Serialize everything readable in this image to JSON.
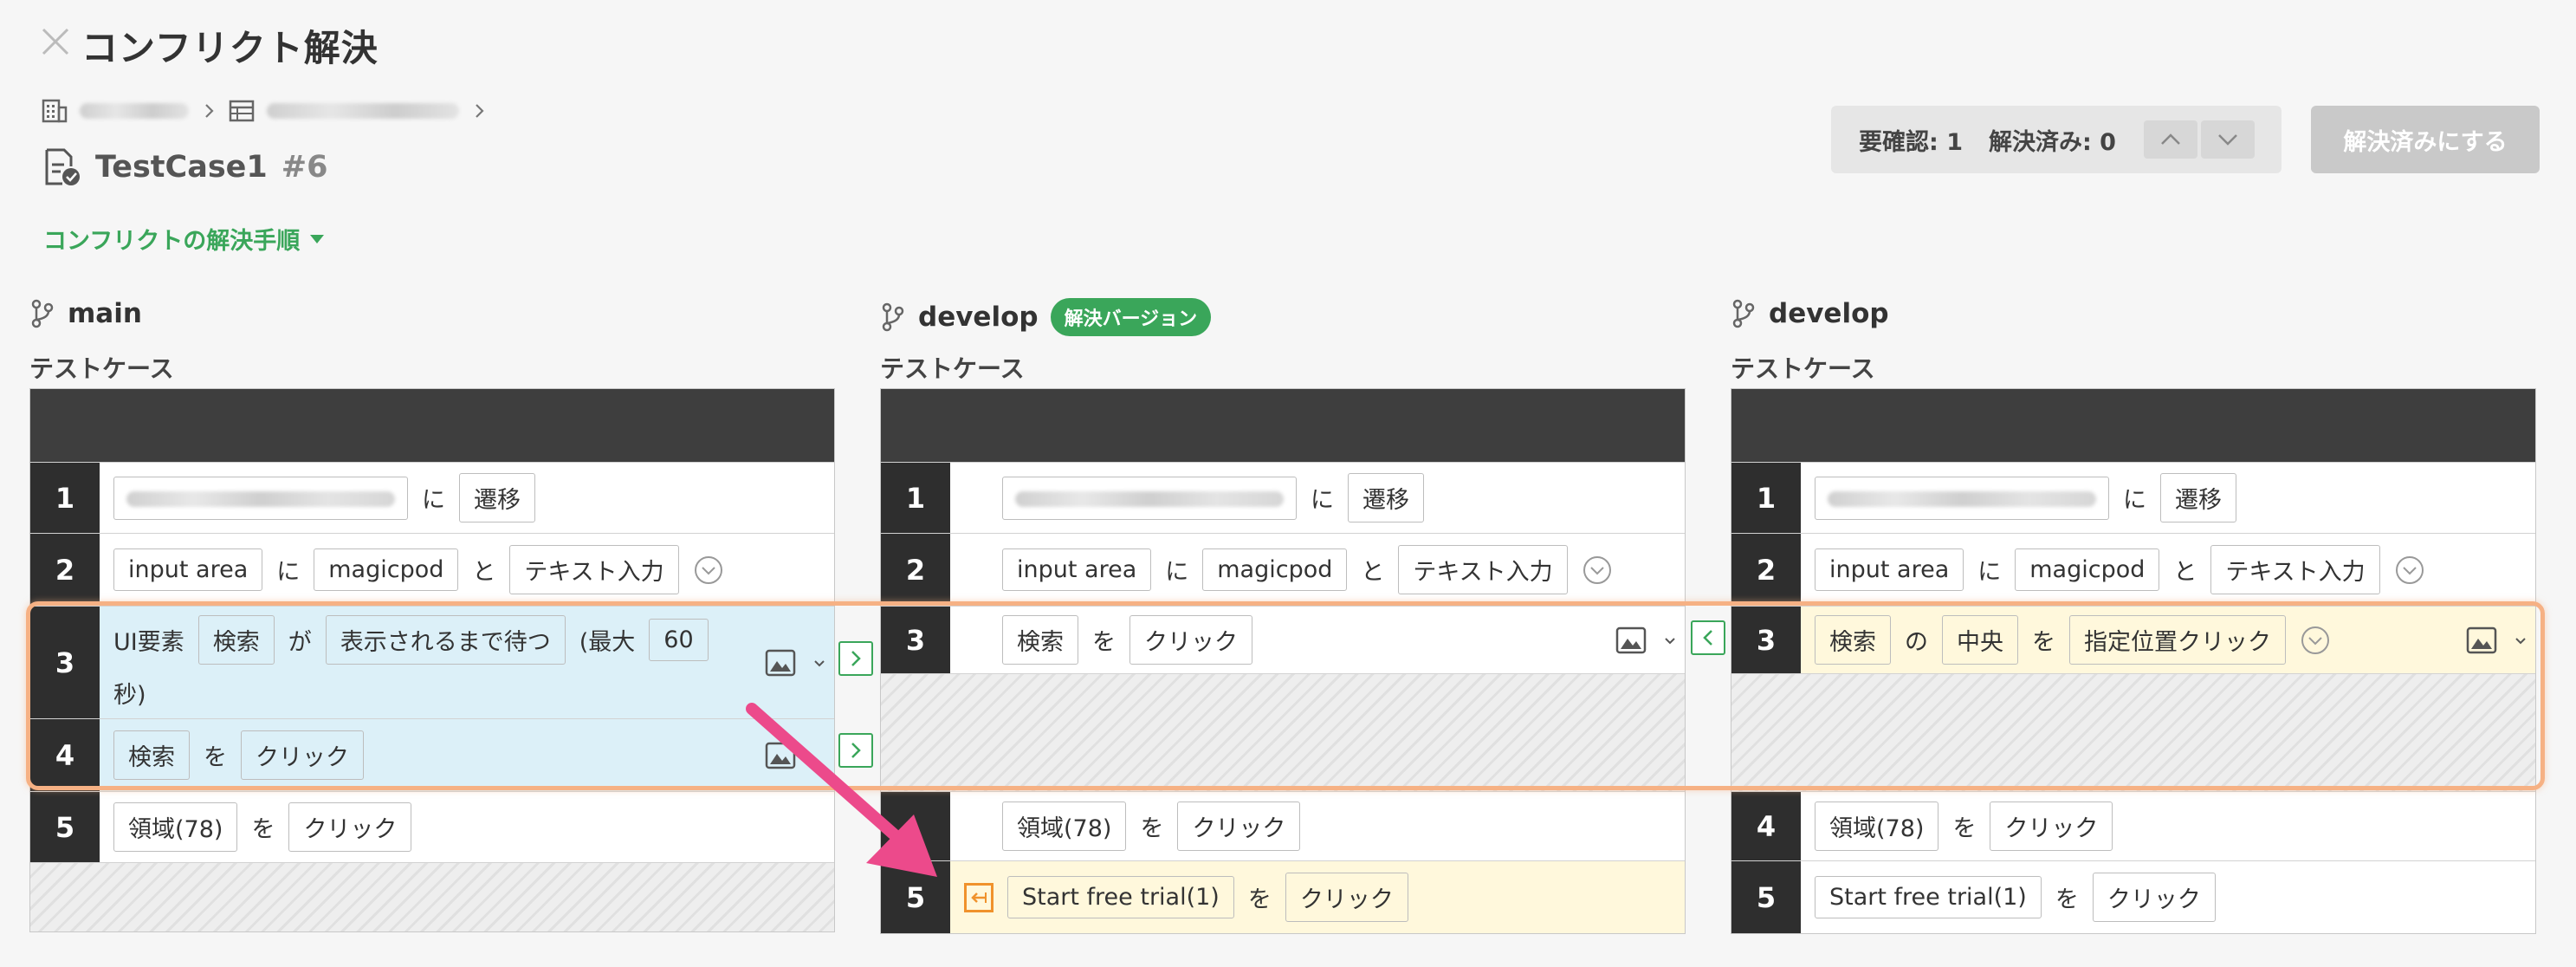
{
  "header": {
    "title": "コンフリクト解決",
    "testcase_name": "TestCase1",
    "testcase_number": "#6",
    "guide_label": "コンフリクトの解決手順"
  },
  "status": {
    "needs_check": "要確認: 1",
    "resolved": "解決済み: 0",
    "resolve_button": "解決済みにする"
  },
  "columns": {
    "left": {
      "branch": "main",
      "label": "テストケース"
    },
    "middle": {
      "branch": "develop",
      "badge": "解決バージョン",
      "label": "テストケース"
    },
    "right": {
      "branch": "develop",
      "label": "テストケース"
    }
  },
  "rows": {
    "common": {
      "ni": "に",
      "wo": "を",
      "to": "と",
      "ga": "が",
      "no": "の",
      "transition": "遷移",
      "input_area": "input area",
      "magicpod": "magicpod",
      "text_input": "テキスト入力",
      "search": "検索",
      "click": "クリック",
      "region78": "領域(78)",
      "start_trial": "Start free trial(1)"
    },
    "numbers": {
      "n1": "1",
      "n2": "2",
      "n3": "3",
      "n4": "4",
      "n5": "5"
    },
    "left3": {
      "ui_element": "UI要素",
      "wait_until_shown": "表示されるまで待つ",
      "max_prefix": "(最大",
      "seconds_value": "60",
      "seconds_suffix": "秒)"
    },
    "right3": {
      "center": "中央",
      "click_position": "指定位置クリック"
    }
  }
}
